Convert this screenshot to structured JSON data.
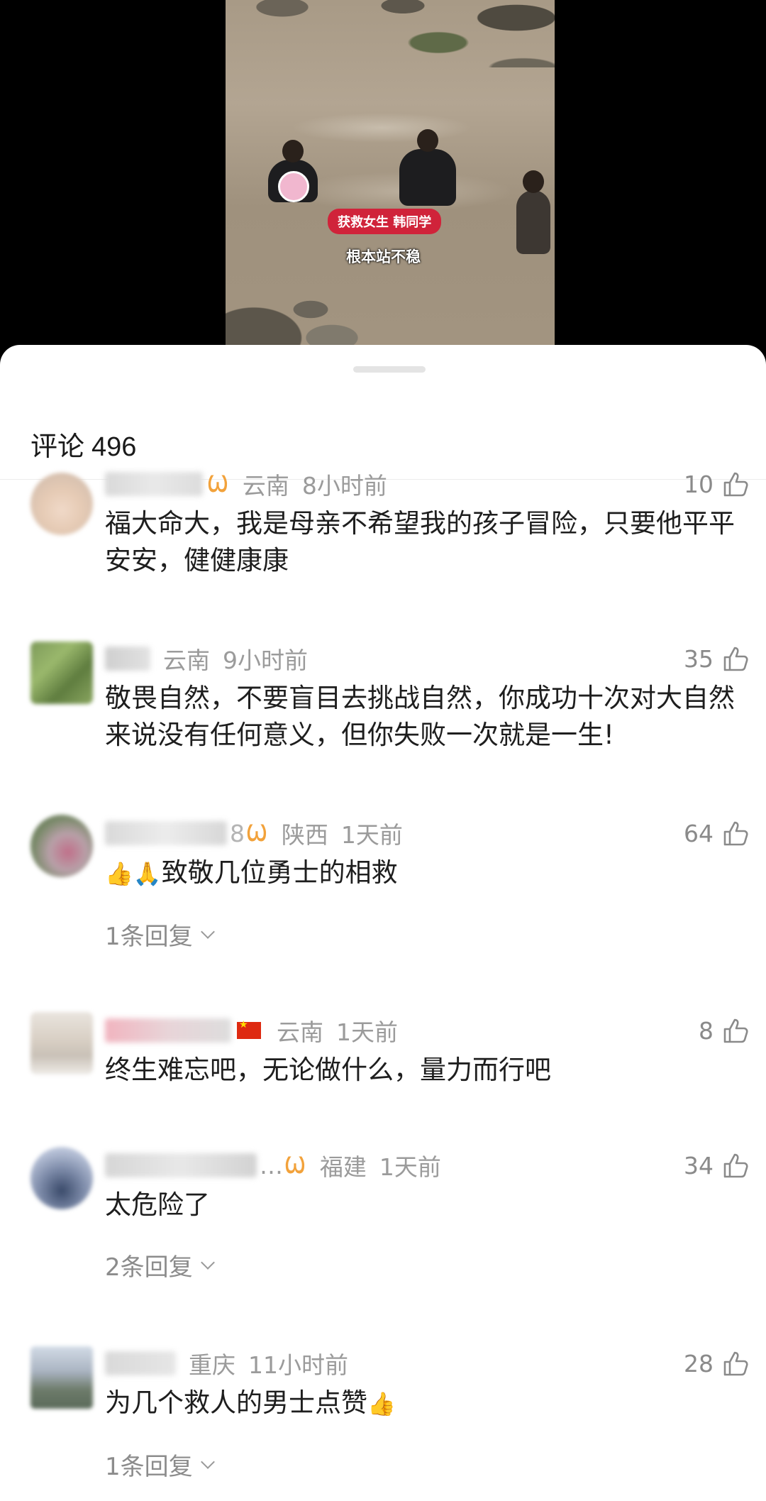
{
  "video": {
    "caption_badge": "获救女生 韩同学",
    "caption_sub": "根本站不稳"
  },
  "comments_panel": {
    "title": "评论",
    "count": "496"
  },
  "comments": [
    {
      "name_tail": "",
      "badge": "butterfly-badge",
      "region": "云南",
      "time": "8小时前",
      "likes": "10",
      "text": "福大命大，我是母亲不希望我的孩子冒险，只要他平平安安，健健康康",
      "reply": ""
    },
    {
      "name_tail": "",
      "badge": "",
      "region": "云南",
      "time": "9小时前",
      "likes": "35",
      "text": "敬畏自然，不要盲目去挑战自然，你成功十次对大自然来说没有任何意义，但你失败一次就是一生!",
      "reply": ""
    },
    {
      "name_tail": "8",
      "badge": "butterfly-badge",
      "region": "陕西",
      "time": "1天前",
      "likes": "64",
      "text_prefix": "👍🙏",
      "text": "致敬几位勇士的相救",
      "reply": "1条回复"
    },
    {
      "name_tail": "",
      "badge": "china-flag",
      "region": "云南",
      "time": "1天前",
      "likes": "8",
      "text": "终生难忘吧，无论做什么，量力而行吧",
      "reply": ""
    },
    {
      "name_tail": "…",
      "badge": "butterfly-badge",
      "region": "福建",
      "time": "1天前",
      "likes": "34",
      "text": "太危险了",
      "reply": "2条回复"
    },
    {
      "name_tail": "",
      "badge": "",
      "region": "重庆",
      "time": "11小时前",
      "likes": "28",
      "text": "为几个救人的男士点赞",
      "text_suffix": "👍",
      "reply": "1条回复"
    }
  ],
  "colors": {
    "badge": "#f2a23b",
    "caption_red": "#d0233a",
    "meta_gray": "#9b9b9b"
  }
}
